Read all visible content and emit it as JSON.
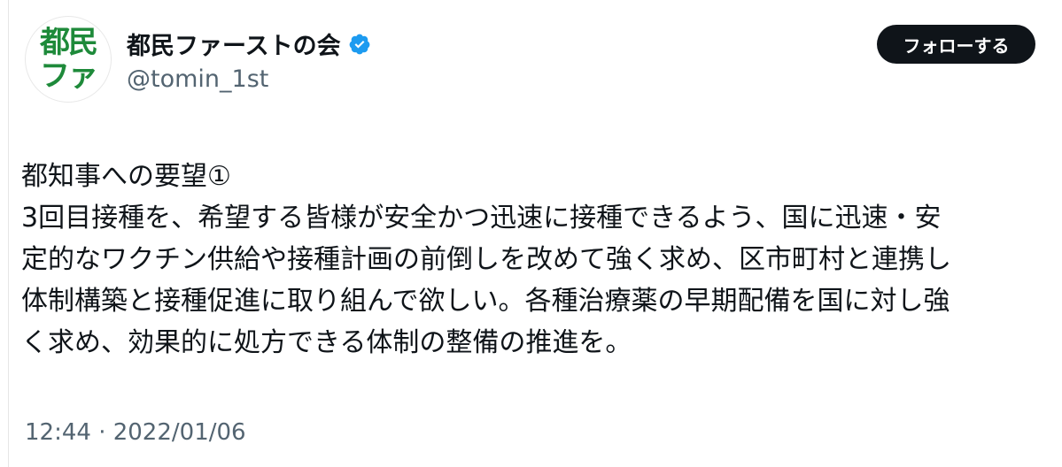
{
  "account": {
    "avatar_text_line1": "都民",
    "avatar_text_line2": "ファ",
    "display_name": "都民ファーストの会",
    "handle": "@tomin_1st",
    "verified_icon": "verified-badge-icon"
  },
  "actions": {
    "follow_label": "フォローする"
  },
  "tweet": {
    "highlight_title": "都知事への要望①",
    "line2_highlight": "3回目接種",
    "line2_rest": "を、希望する皆様が安全かつ迅速に接種できるよう、国に迅速・安",
    "line3": "定的なワクチン供給や接種計画の前倒しを改めて強く求め、区市町村と連携し",
    "line4": "体制構築と接種促進に取り組んで欲しい。各種治療薬の早期配備を国に対し強",
    "line5": "く求め、効果的に処方できる体制の整備の推進を。",
    "timestamp": "12:44 · 2022/01/06"
  },
  "colors": {
    "avatar_green": "#1e8a3a",
    "verified_blue": "#1d9bf0",
    "highlight_yellow": "#ffd728",
    "button_black": "#0f1419",
    "secondary_text": "#536471"
  }
}
